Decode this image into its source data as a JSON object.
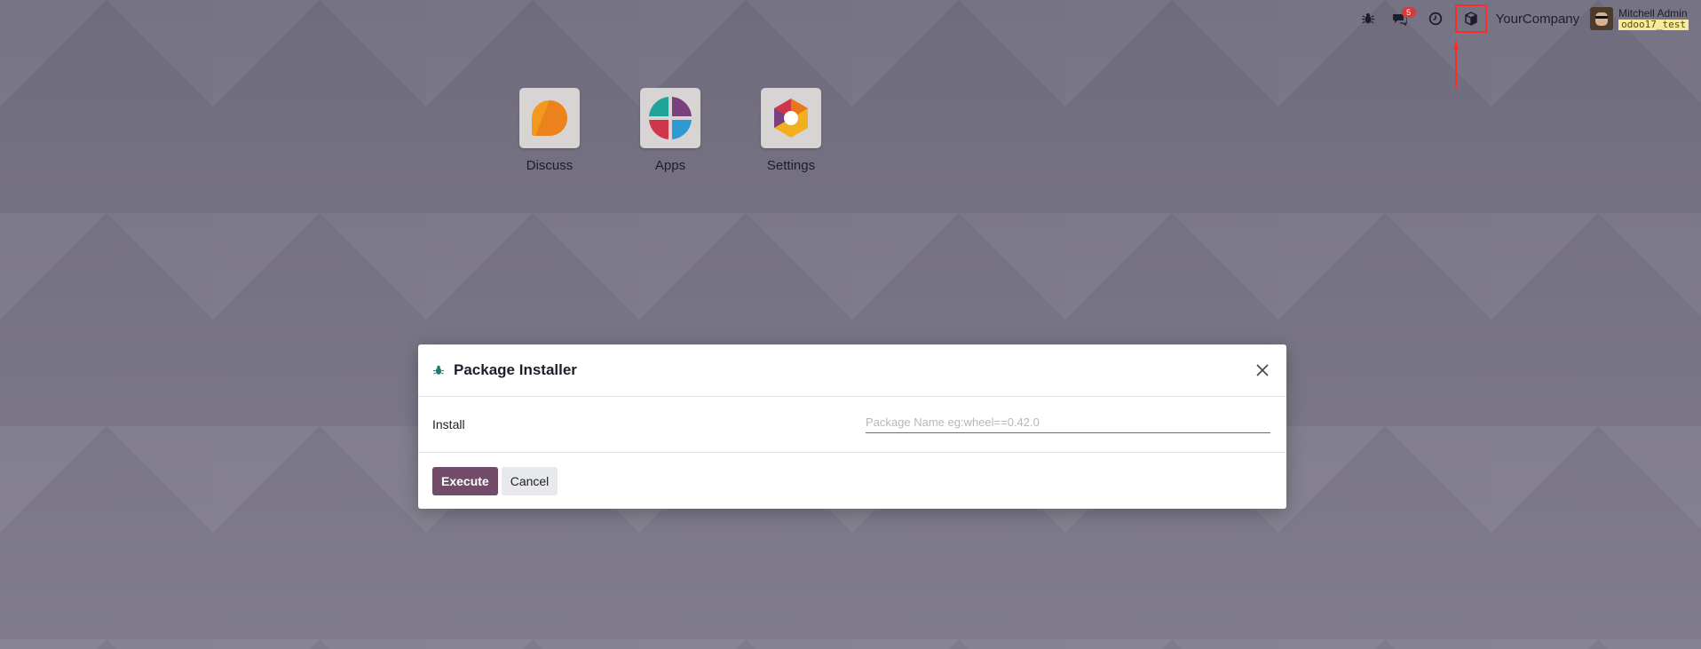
{
  "navbar": {
    "debug_icon": "bug-icon",
    "chat_badge": "5",
    "company": "YourCompany",
    "user_name": "Mitchell Admin",
    "database": "odoo17_test"
  },
  "apps": [
    {
      "label": "Discuss",
      "icon": "discuss-icon"
    },
    {
      "label": "Apps",
      "icon": "apps-icon"
    },
    {
      "label": "Settings",
      "icon": "settings-icon"
    }
  ],
  "modal": {
    "title": "Package Installer",
    "field_label": "Install",
    "input_value": "",
    "input_placeholder": "Package Name eg:wheel==0.42.0",
    "execute_label": "Execute",
    "cancel_label": "Cancel"
  },
  "colors": {
    "primary": "#714b67",
    "annotation": "#ff2a2a",
    "badge": "#d43a3a"
  }
}
